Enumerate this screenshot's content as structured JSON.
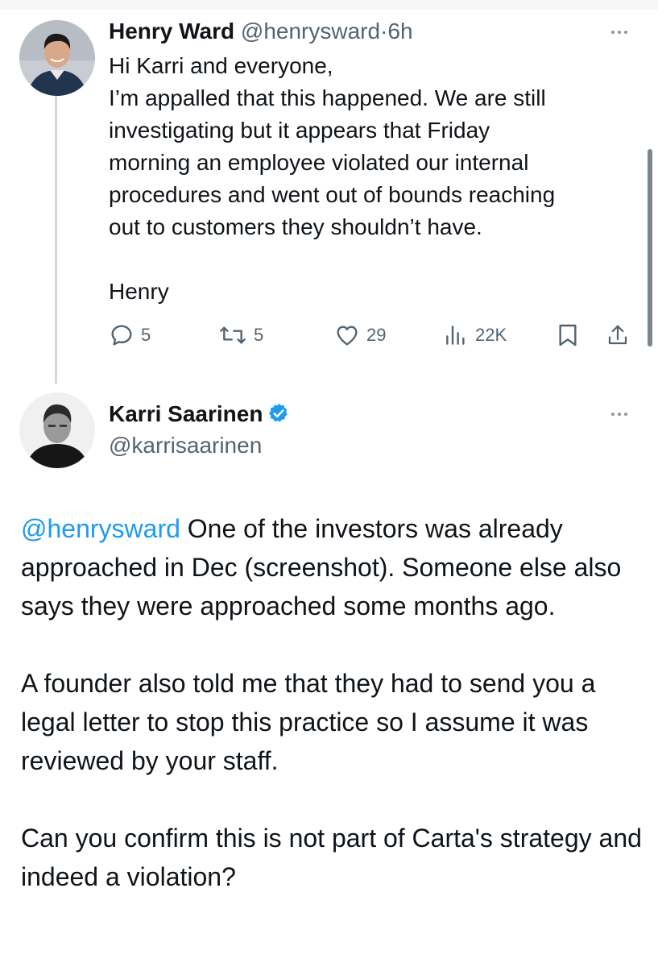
{
  "thread": {
    "reply": {
      "author_name": "Henry Ward",
      "author_handle": "@henrysward",
      "separator": "·",
      "time": "6h",
      "avatar_icon": "profile-photo",
      "body_lines": [
        "Hi Karri and everyone,",
        "I’m appalled that this happened. We are still",
        "investigating but it appears that Friday",
        "morning an employee violated our internal",
        "procedures and went out of bounds reaching",
        "out to customers they shouldn’t have."
      ],
      "signature": "Henry",
      "actions": {
        "reply_count": "5",
        "repost_count": "5",
        "like_count": "29",
        "view_count": "22K"
      }
    },
    "quoted": {
      "author_name": "Karri Saarinen",
      "author_handle": "@karrisaarinen",
      "verified": true,
      "avatar_icon": "profile-photo",
      "mention": "@henrysward",
      "paragraph1_rest": " One of the investors was already approached in Dec (screenshot). Someone else also says they were approached some months ago.",
      "paragraph2": "A founder also told me that they had to send you a legal letter to stop this practice so I assume it was reviewed by your staff.",
      "paragraph3": "Can you confirm this is not part of Carta's strategy and indeed a violation?"
    }
  },
  "colors": {
    "text": "#0f1419",
    "secondary": "#536471",
    "link": "#1d9bf0",
    "thread_line": "#cfd9de"
  }
}
